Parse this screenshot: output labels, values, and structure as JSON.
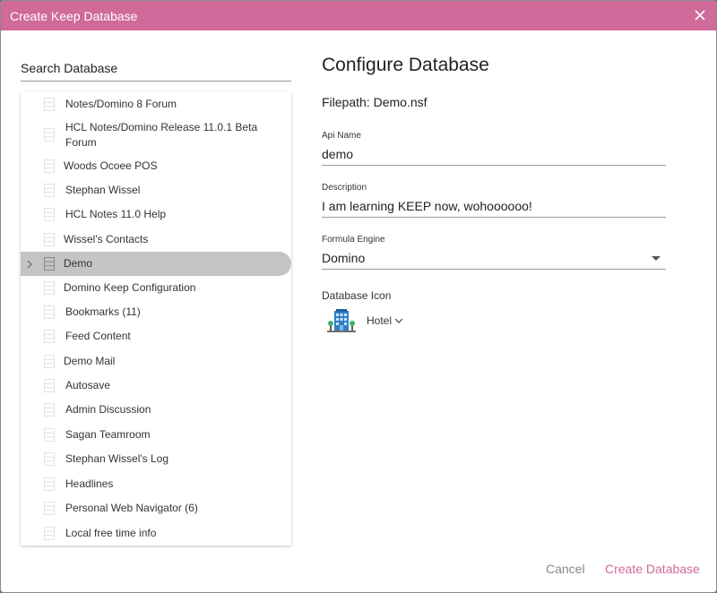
{
  "dialog": {
    "title": "Create Keep Database",
    "close_icon": "close-icon"
  },
  "search": {
    "placeholder": "Search Database"
  },
  "databases": [
    {
      "label": "Notes/Domino 8 Forum"
    },
    {
      "label": "HCL Notes/Domino Release 11.0.1 Beta Forum"
    },
    {
      "label": "Woods Ocoee POS"
    },
    {
      "label": "Stephan Wissel"
    },
    {
      "label": "HCL Notes 11.0 Help"
    },
    {
      "label": "Wissel's Contacts"
    },
    {
      "label": "Demo",
      "selected": true
    },
    {
      "label": "Domino Keep Configuration"
    },
    {
      "label": "Bookmarks (11)"
    },
    {
      "label": "Feed Content"
    },
    {
      "label": "Demo Mail"
    },
    {
      "label": "Autosave"
    },
    {
      "label": "Admin Discussion"
    },
    {
      "label": "Sagan Teamroom"
    },
    {
      "label": "Stephan Wissel's Log"
    },
    {
      "label": "Headlines"
    },
    {
      "label": "Personal Web Navigator (6)"
    },
    {
      "label": "Local free time info"
    }
  ],
  "config": {
    "title": "Configure Database",
    "filepath": "Filepath: Demo.nsf",
    "api_name_label": "Api Name",
    "api_name_value": "demo",
    "description_label": "Description",
    "description_value": "I am learning KEEP now, wohoooooo!",
    "formula_engine_label": "Formula Engine",
    "formula_engine_value": "Domino",
    "icon_label": "Database Icon",
    "icon_value": "Hotel",
    "icon_name": "hotel-icon"
  },
  "footer": {
    "cancel_label": "Cancel",
    "create_label": "Create Database"
  },
  "colors": {
    "accent": "#cf6a9a",
    "selected_row": "#c4c4c4"
  }
}
